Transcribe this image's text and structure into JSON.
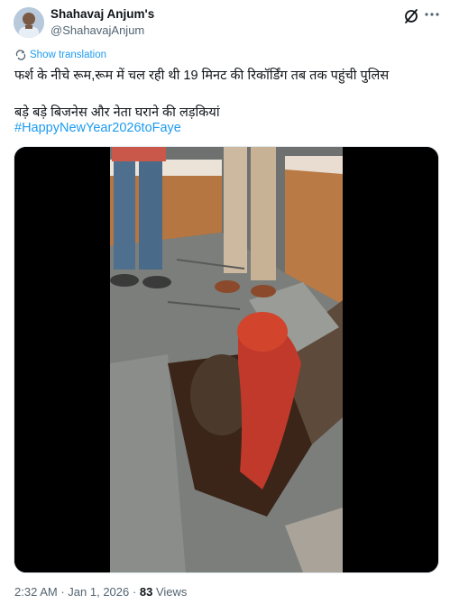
{
  "author": {
    "display_name": "Shahavaj Anjum's",
    "handle": "@ShahavajAnjum"
  },
  "translation": {
    "label": "Show translation"
  },
  "post": {
    "line1": "फर्श के नीचे रूम,रूम में चल रही थी 19 मिनट की रिकॉर्डिंग तब तक पहुंची पुलिस",
    "line2": "बड़े बड़े बिजनेस और नेता घराने की लड़कियां",
    "hashtag": "#HappyNewYear2026toFaye"
  },
  "media": {
    "type": "video",
    "description_icon": "video-thumbnail"
  },
  "footer": {
    "time": "2:32 AM",
    "separator1": "·",
    "date": "Jan 1, 2026",
    "separator2": "·",
    "views_count": "83",
    "views_label": "Views"
  },
  "colors": {
    "accent": "#1d9bf0",
    "secondary_text": "#536471",
    "primary_text": "#0f1419"
  }
}
